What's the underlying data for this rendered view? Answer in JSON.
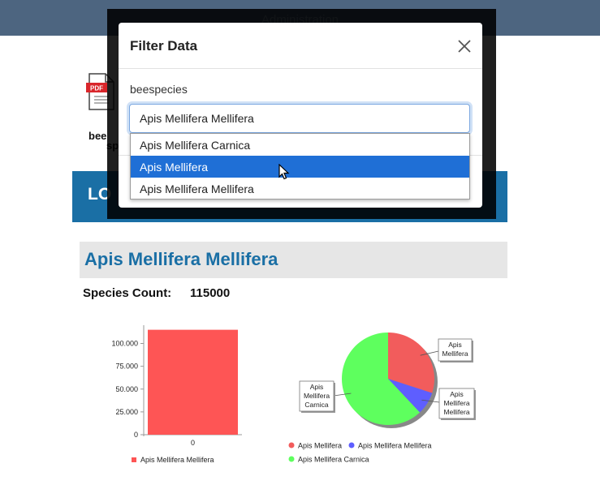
{
  "topbar": {
    "title": "Administration"
  },
  "background": {
    "pdf_badge": "PDF",
    "report_link_line1": "bee",
    "report_link_line2": "sp",
    "band_text": "LO"
  },
  "report": {
    "title": "Apis Mellifera Mellifera",
    "count_label": "Species Count:",
    "count_value": "115000"
  },
  "modal": {
    "title": "Filter Data",
    "field_label": "beespecies",
    "selected_value": "Apis Mellifera Mellifera",
    "options": [
      "Apis Mellifera Carnica",
      "Apis Mellifera",
      "Apis Mellifera Mellifera"
    ],
    "highlighted_index": 1
  },
  "chart_data": [
    {
      "type": "bar",
      "categories": [
        "0"
      ],
      "series": [
        {
          "name": "Apis Mellifera Mellifera",
          "values": [
            115000
          ],
          "color": "#fe5555"
        }
      ],
      "ylim": [
        0,
        120000
      ],
      "yticks": [
        "0",
        "25.000",
        "50.000",
        "75.000",
        "100.000"
      ],
      "ytick_values": [
        0,
        25000,
        50000,
        75000,
        100000
      ],
      "legend_position": "bottom-left"
    },
    {
      "type": "pie",
      "slices": [
        {
          "label": "Apis Mellifera",
          "value": 30,
          "color": "#f25c5c",
          "callout": [
            "Apis",
            "Mellifera"
          ]
        },
        {
          "label": "Apis Mellifera Mellifera",
          "value": 8,
          "color": "#5e5eff",
          "callout": [
            "Apis",
            "Mellifera",
            "Mellifera"
          ]
        },
        {
          "label": "Apis Mellifera Carnica",
          "value": 62,
          "color": "#5eff5e",
          "callout": [
            "Apis",
            "Mellifera",
            "Carnica"
          ]
        }
      ],
      "legend": [
        "Apis Mellifera",
        "Apis Mellifera Mellifera",
        "Apis Mellifera Carnica"
      ],
      "legend_position": "bottom"
    }
  ]
}
